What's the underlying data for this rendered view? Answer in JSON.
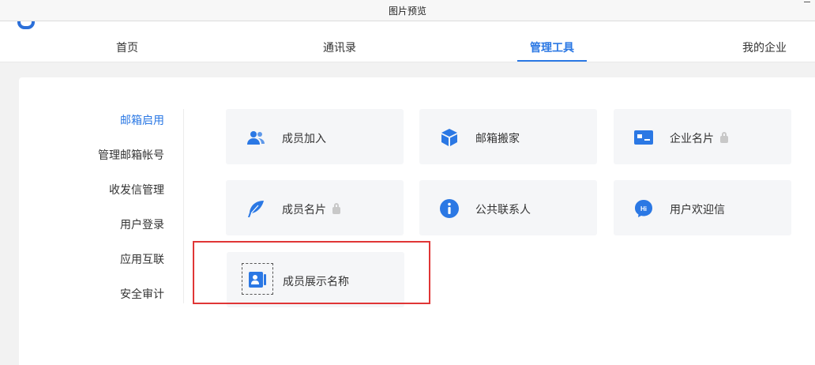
{
  "window": {
    "title": "图片预览"
  },
  "nav": {
    "tabs": [
      {
        "label": "首页",
        "active": false
      },
      {
        "label": "通讯录",
        "active": false
      },
      {
        "label": "管理工具",
        "active": true
      },
      {
        "label": "我的企业",
        "active": false
      }
    ]
  },
  "sidebar": {
    "items": [
      {
        "label": "邮箱启用",
        "active": true
      },
      {
        "label": "管理邮箱帐号",
        "active": false
      },
      {
        "label": "收发信管理",
        "active": false
      },
      {
        "label": "用户登录",
        "active": false
      },
      {
        "label": "应用互联",
        "active": false
      },
      {
        "label": "安全审计",
        "active": false
      }
    ]
  },
  "tools": [
    {
      "label": "成员加入",
      "icon": "users-icon",
      "locked": false
    },
    {
      "label": "邮箱搬家",
      "icon": "box-icon",
      "locked": false
    },
    {
      "label": "企业名片",
      "icon": "card-icon",
      "locked": true
    },
    {
      "label": "成员名片",
      "icon": "feather-icon",
      "locked": true
    },
    {
      "label": "公共联系人",
      "icon": "info-icon",
      "locked": false
    },
    {
      "label": "用户欢迎信",
      "icon": "hi-chat-icon",
      "locked": false
    },
    {
      "label": "成员展示名称",
      "icon": "contact-card-icon",
      "locked": false
    }
  ],
  "colors": {
    "accent": "#2b78e4",
    "highlight": "#e03636",
    "tile_bg": "#f5f6f8"
  }
}
